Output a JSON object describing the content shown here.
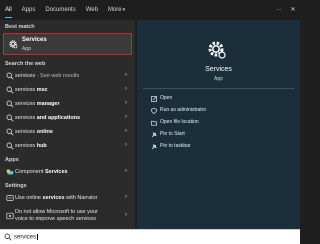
{
  "tabs": [
    {
      "label": "All"
    },
    {
      "label": "Apps"
    },
    {
      "label": "Documents"
    },
    {
      "label": "Web"
    },
    {
      "label": "More"
    }
  ],
  "tab_icons": [
    "more-icon",
    "close-icon"
  ],
  "sections": {
    "best_match": "Best match",
    "search_web": "Search the web",
    "apps": "Apps",
    "settings": "Settings"
  },
  "best_match": {
    "title": "Services",
    "subtitle": "App"
  },
  "web_results": [
    {
      "bold": "services",
      "rest": " - See web results"
    },
    {
      "bold": "services ",
      "rest": "msc"
    },
    {
      "bold": "services ",
      "rest": "manager"
    },
    {
      "bold": "services ",
      "rest": "and applications"
    },
    {
      "bold": "services ",
      "rest": "online"
    },
    {
      "bold": "services ",
      "rest": "hub"
    }
  ],
  "apps": [
    {
      "pre": "Component ",
      "bold": "Services",
      "post": ""
    }
  ],
  "settings": [
    {
      "pre": "Use online ",
      "bold": "services",
      "post": " with Narrator"
    },
    {
      "line1": "Do not allow Microsoft to use your",
      "line2": "voice to improve speech services"
    }
  ],
  "detail": {
    "title": "Services",
    "subtitle": "App",
    "actions": [
      {
        "label": "Open",
        "icon": "open-icon"
      },
      {
        "label": "Run as administrator",
        "icon": "shield-icon"
      },
      {
        "label": "Open file location",
        "icon": "folder-icon"
      },
      {
        "label": "Pin to Start",
        "icon": "pin-icon"
      },
      {
        "label": "Pin to taskbar",
        "icon": "pin-taskbar-icon"
      }
    ]
  },
  "search": {
    "value": "services"
  },
  "colors": {
    "accent": "#4cc2ff",
    "highlight_border": "#c42b2b",
    "panel": "#2b2b2b",
    "detail_panel": "#1a2e3b"
  }
}
